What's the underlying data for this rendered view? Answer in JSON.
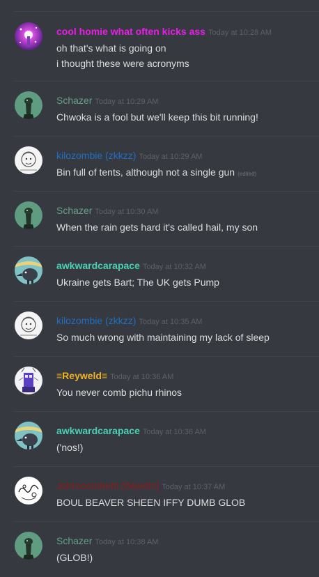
{
  "messages": [
    {
      "username": "cool homie what often kicks ass",
      "username_color": "#e91ee9",
      "timestamp": "Today at 10:28 AM",
      "lines": [
        "oh that's what  is going on",
        "i thought these were acronyms"
      ],
      "avatar": "sparkle-avatar-icon"
    },
    {
      "username": "Schazer",
      "username_color": "#64a187",
      "timestamp": "Today at 10:29 AM",
      "lines": [
        "Chwoka is a fool but we'll keep this bit running!"
      ],
      "avatar": "creature-avatar-icon"
    },
    {
      "username": "kilozombie (zkkzz)",
      "username_color": "#1e6fc4",
      "timestamp": "Today at 10:29 AM",
      "lines": [
        "Bin full of tents, although not a single gun"
      ],
      "edited": "(edited)",
      "avatar": "sketch-avatar-icon"
    },
    {
      "username": "Schazer",
      "username_color": "#64a187",
      "timestamp": "Today at 10:30 AM",
      "lines": [
        "When the rain gets hard it's called hail, my son"
      ],
      "avatar": "creature-avatar-icon"
    },
    {
      "username": "awkwardcarapace",
      "username_color": "#48d2b3",
      "timestamp": "Today at 10:32 AM",
      "lines": [
        "Ukraine gets Bart; The UK gets Pump"
      ],
      "avatar": "crow-avatar-icon"
    },
    {
      "username": "kilozombie (zkkzz)",
      "username_color": "#1e6fc4",
      "timestamp": "Today at 10:35 AM",
      "lines": [
        "So much wrong with maintaining my lack of sleep"
      ],
      "avatar": "sketch-avatar-icon"
    },
    {
      "username": "≡Reyweld≡",
      "username_color": "#f0b323",
      "timestamp": "Today at 10:36 AM",
      "lines": [
        "You never comb pichu rhinos"
      ],
      "avatar": "robot-avatar-icon"
    },
    {
      "username": "awkwardcarapace",
      "username_color": "#48d2b3",
      "timestamp": "Today at 10:36 AM",
      "lines": [
        "('nos!)"
      ],
      "avatar": "crow-avatar-icon"
    },
    {
      "username": "Johroonotheth [!Myeth!]",
      "username_color": "#8a1c1c",
      "timestamp": "Today at 10:37 AM",
      "lines": [
        "BOUL BEAVER SHEEN IFFY DUMB GLOB"
      ],
      "avatar": "doodle-avatar-icon"
    },
    {
      "username": "Schazer",
      "username_color": "#64a187",
      "timestamp": "Today at 10:38 AM",
      "lines": [
        "(GLOB!)"
      ],
      "avatar": "creature-avatar-icon"
    }
  ]
}
